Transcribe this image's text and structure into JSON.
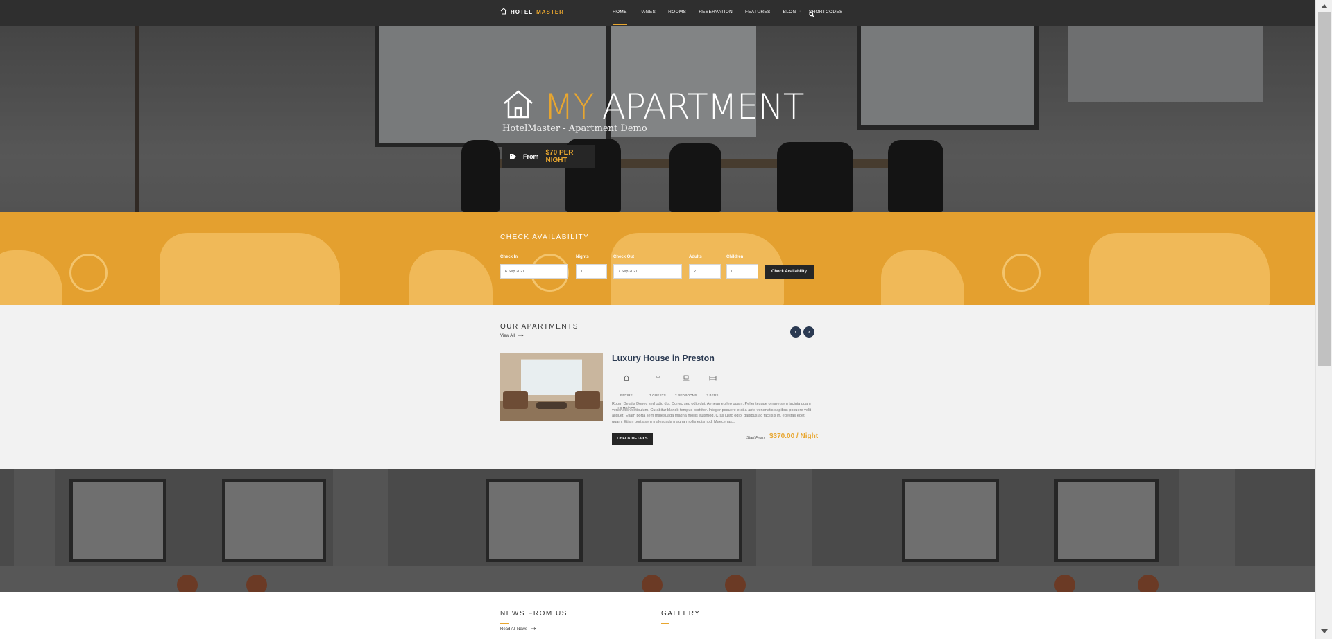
{
  "nav": {
    "logo_word1": "HOTEL",
    "logo_word2": "MASTER",
    "items": [
      {
        "label": "HOME",
        "active": true
      },
      {
        "label": "PAGES",
        "active": false
      },
      {
        "label": "ROOMS",
        "active": false
      },
      {
        "label": "RESERVATION",
        "active": false
      },
      {
        "label": "FEATURES",
        "active": false
      },
      {
        "label": "BLOG",
        "active": false
      },
      {
        "label": "SHORTCODES",
        "active": false
      }
    ],
    "icons": {
      "logo": "house-icon",
      "search": "search-icon"
    }
  },
  "hero": {
    "title_highlight": "MY",
    "title_main": "APARTMENT",
    "subtitle": "HotelMaster - Apartment Demo",
    "price_prefix": "From",
    "price_value": "$70 PER NIGHT",
    "icons": {
      "title": "house-icon",
      "price": "tag-icon"
    }
  },
  "availability": {
    "title": "CHECK AVAILABILITY",
    "fields": [
      {
        "label": "Check In",
        "value": "6 Sep 2021"
      },
      {
        "label": "Nights",
        "value": "1"
      },
      {
        "label": "Check Out",
        "value": "7 Sep 2021"
      },
      {
        "label": "Adults",
        "value": "2"
      },
      {
        "label": "Children",
        "value": "0"
      }
    ],
    "button": "Check Availability"
  },
  "apartments": {
    "title": "OUR APARTMENTS",
    "view_all": "View All",
    "item": {
      "name": "Luxury House in Preston",
      "features": [
        {
          "icon": "home-icon",
          "label": "ENTIRE HOME/APT"
        },
        {
          "icon": "guests-icon",
          "label": "7 GUESTS"
        },
        {
          "icon": "bedroom-icon",
          "label": "2 BEDROOMS"
        },
        {
          "icon": "bed-icon",
          "label": "3 BEDS"
        }
      ],
      "description": "Room Details Donec sed odio dui. Donec sed odio dui. Aenean eu leo quam. Pellentesque ornare sem lacinia quam venenatis vestibulum. Curabitur blandit tempus porttitor. Integer posuere erat a ante venenatis dapibus posuere velit aliquet. Etiam porta sem malesuada magna mollis euismod. Cras justo odio, dapibus ac facilisis in, egestas eget quam. Etiam porta sem malesuada magna mollis euismod. Maecenas...",
      "button": "CHECK DETAILS",
      "start_from": "Start From",
      "price": "$370.00 / Night"
    }
  },
  "news": {
    "title": "NEWS FROM US",
    "read_all": "Read All News"
  },
  "gallery": {
    "title": "GALLERY"
  },
  "colors": {
    "accent": "#e8a62f",
    "dark": "#262626",
    "navy": "#2b3a52"
  }
}
